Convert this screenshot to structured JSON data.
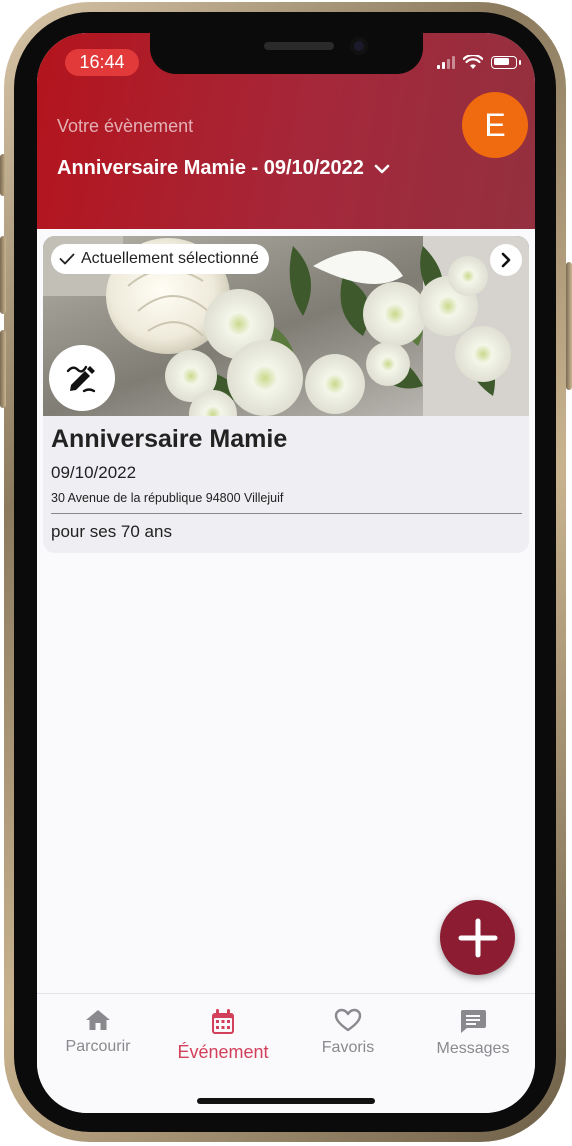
{
  "status_bar": {
    "time": "16:44"
  },
  "header": {
    "label": "Votre évènement",
    "selected_event": "Anniversaire Mamie - 09/10/2022",
    "avatar_initial": "E",
    "colors": {
      "background": "#b4141d",
      "avatar": "#f06a0f"
    }
  },
  "event_card": {
    "badge": "Actuellement sélectionné",
    "title": "Anniversaire Mamie",
    "date": "09/10/2022",
    "address": "30 Avenue de la république  94800 Villejuif",
    "description": "pour ses 70 ans",
    "image": "white-roses-chrysanthemums-bouquet",
    "icons": [
      "check-icon",
      "chevron-right-icon",
      "edit-pencil-icon"
    ]
  },
  "fab": {
    "icon": "plus-icon",
    "color": "#8c1c31"
  },
  "bottom_nav": {
    "items": [
      {
        "label": "Parcourir",
        "icon": "home-icon",
        "active": false
      },
      {
        "label": "Événement",
        "icon": "calendar-icon",
        "active": true
      },
      {
        "label": "Favoris",
        "icon": "heart-icon",
        "active": false
      },
      {
        "label": "Messages",
        "icon": "message-icon",
        "active": false
      }
    ],
    "active_color": "#d2405a"
  }
}
